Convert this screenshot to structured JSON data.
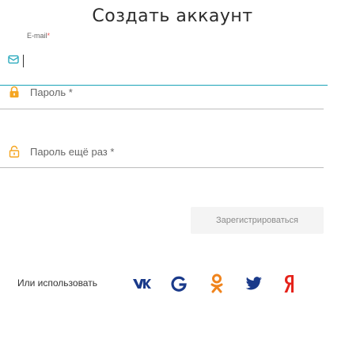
{
  "page": {
    "title": "Создать аккаунт"
  },
  "form": {
    "email": {
      "label": "E-mail",
      "required_mark": "*",
      "value": ""
    },
    "password": {
      "label": "Пароль",
      "required_mark": "*",
      "value": ""
    },
    "password_repeat": {
      "label": "Пароль ещё раз",
      "required_mark": "*",
      "value": ""
    },
    "submit_label": "Зарегистрироваться"
  },
  "social": {
    "label": "Или использовать",
    "providers": [
      {
        "name": "vk-icon",
        "color": "#1a3a8a"
      },
      {
        "name": "google-icon",
        "color": "#1a3a8a"
      },
      {
        "name": "odnoklassniki-icon",
        "color": "#f0841d"
      },
      {
        "name": "twitter-icon",
        "color": "#1a3a8a"
      },
      {
        "name": "yandex-icon",
        "color": "#e5231b"
      }
    ]
  },
  "colors": {
    "accent_underline": "#1aa3b8",
    "icon_accent": "#f5a623"
  }
}
